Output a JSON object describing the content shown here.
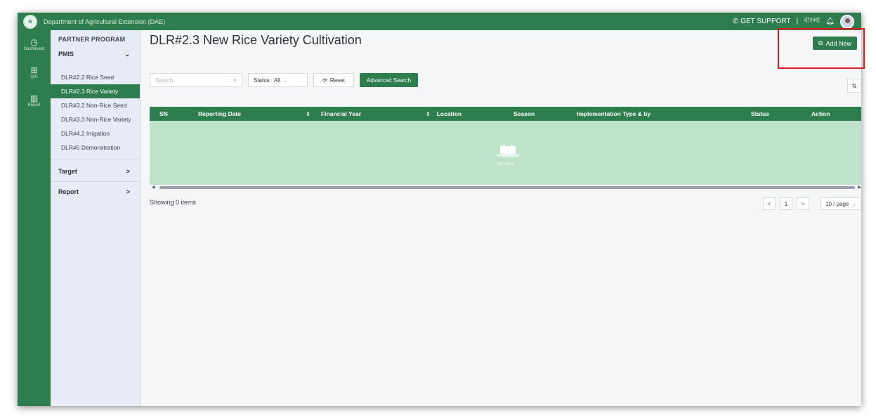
{
  "header": {
    "org_name": "Department of Agricultural Extension (DAE)",
    "support_label": "GET SUPPORT",
    "divider": "|",
    "language": "বাংলা"
  },
  "rail": {
    "items": [
      {
        "label": "Dashboard",
        "icon": "dashboard-icon",
        "glyph": "◷"
      },
      {
        "label": "QIS",
        "icon": "grid-icon",
        "glyph": "⊞"
      },
      {
        "label": "Report",
        "icon": "report-icon",
        "glyph": "▥"
      }
    ]
  },
  "sidebar": {
    "section_title": "PARTNER PROGRAM",
    "pmis": {
      "label": "PMIS",
      "chevron": "⌄"
    },
    "items": [
      {
        "label": "DLR#2.2 Rice Seed",
        "active": false
      },
      {
        "label": "DLR#2.3 Rice Variety",
        "active": true
      },
      {
        "label": "DLR#3.2 Non-Rice Seed",
        "active": false
      },
      {
        "label": "DLR#3.3 Non-Rice Variety",
        "active": false
      },
      {
        "label": "DLR#4.2 Irrigation",
        "active": false
      },
      {
        "label": "DLR#5 Demonstration",
        "active": false
      }
    ],
    "target": {
      "label": "Target",
      "chevron": ">"
    },
    "report": {
      "label": "Report",
      "chevron": ">"
    }
  },
  "main": {
    "title": "DLR#2.3 New Rice Variety Cultivation",
    "add_new_label": "Add New",
    "search_placeholder": "Search",
    "status_label": "Status:",
    "status_value": "All",
    "reset_label": "Reset",
    "advanced_search_label": "Advanced Search",
    "side_tool_label": "⇅"
  },
  "table": {
    "columns": [
      {
        "label": "SN",
        "sortable": false
      },
      {
        "label": "Reporting Date",
        "sortable": true
      },
      {
        "label": "Financial Year",
        "sortable": true
      },
      {
        "label": "Location",
        "sortable": false
      },
      {
        "label": "Season",
        "sortable": false
      },
      {
        "label": "Implementation Type & by",
        "sortable": false
      },
      {
        "label": "Status",
        "sortable": false
      },
      {
        "label": "Action",
        "sortable": false
      }
    ],
    "empty_text": "No data",
    "sort_glyph": "⇕"
  },
  "pagination": {
    "showing_text": "Showing 0 items",
    "prev": "<",
    "current_page": "1",
    "next": ">",
    "page_size": "10 / page"
  },
  "colors": {
    "brand_green": "#2e7d4f",
    "empty_row_green": "#bfe3ca",
    "highlight_red": "#e11a1a"
  }
}
